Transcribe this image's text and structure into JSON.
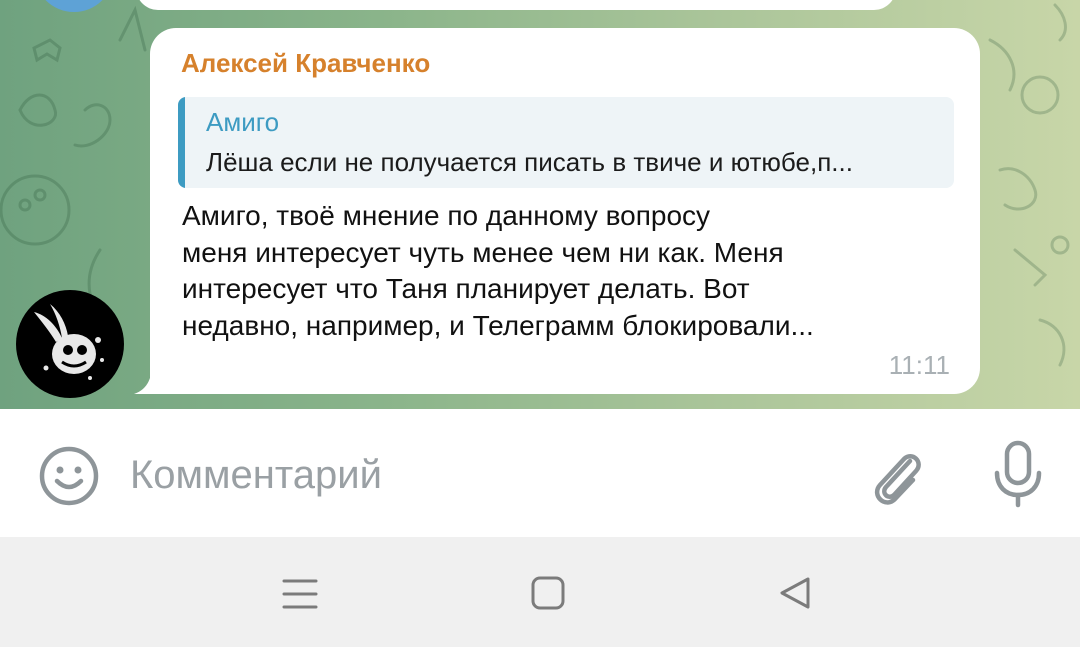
{
  "message": {
    "sender": "Алексей Кравченко",
    "reply": {
      "name": "Амиго",
      "text": "Лёша если не получается писать в твиче и ютюбе,п..."
    },
    "text": "Амиго, твоё мнение по данному вопросу\nменя интересует чуть менее чем ни как. Меня\nинтересует что Таня планирует делать. Вот\nнедавно, например, и Телеграмм блокировали...",
    "time": "11:11"
  },
  "input": {
    "placeholder": "Комментарий",
    "value": ""
  },
  "icons": {
    "emoji": "smile-icon",
    "attach": "paperclip-icon",
    "mic": "microphone-icon",
    "nav_recents": "menu-lines-icon",
    "nav_home": "square-icon",
    "nav_back": "triangle-back-icon"
  },
  "colors": {
    "sender": "#d6812c",
    "reply_accent": "#3d9bc2",
    "time": "#a9b0b4"
  }
}
